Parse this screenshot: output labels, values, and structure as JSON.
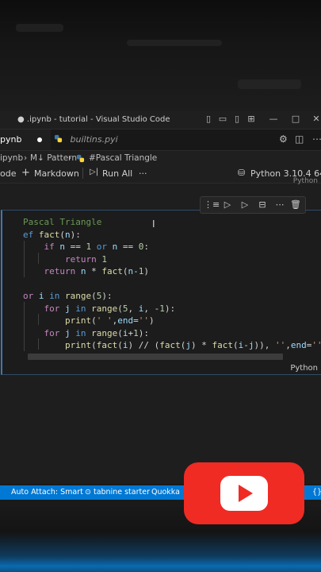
{
  "window": {
    "title": "● .ipynb - tutorial - Visual Studio Code",
    "controls": [
      "layout-sidebar-icon",
      "layout-panel-icon",
      "layout-sidebar-right-icon",
      "layout-grid-icon",
      "minimize-icon",
      "maximize-icon",
      "close-icon"
    ]
  },
  "tabs": [
    {
      "label": "pynb",
      "active": true,
      "dirty": true
    },
    {
      "label": "builtins.pyi",
      "active": false
    }
  ],
  "breadcrumb": {
    "file": "ipynb",
    "section": "M↓ Pattern",
    "cell": "#Pascal Triangle"
  },
  "toolbar": {
    "code": "ode",
    "markdown": "Markdown",
    "run_all": "Run All",
    "more": "···",
    "kernel": "Python 3.10.4 64-bi",
    "kernel_small": "Python"
  },
  "cell": {
    "language": "Python",
    "lines": [
      [
        {
          "t": "Pascal Triangle",
          "c": "cm"
        }
      ],
      [
        {
          "t": "ef ",
          "c": "kw"
        },
        {
          "t": "fact",
          "c": "fn"
        },
        {
          "t": "(",
          "c": "pl"
        },
        {
          "t": "n",
          "c": "var"
        },
        {
          "t": "):",
          "c": "pl"
        }
      ],
      [
        {
          "t": "    "
        },
        {
          "t": "if ",
          "c": "kw2"
        },
        {
          "t": "n",
          "c": "var"
        },
        {
          "t": " == ",
          "c": "pl"
        },
        {
          "t": "1",
          "c": "num"
        },
        {
          "t": " or ",
          "c": "kw"
        },
        {
          "t": "n",
          "c": "var"
        },
        {
          "t": " == ",
          "c": "pl"
        },
        {
          "t": "0",
          "c": "num"
        },
        {
          "t": ":",
          "c": "pl"
        }
      ],
      [
        {
          "t": "        "
        },
        {
          "t": "return ",
          "c": "kw2"
        },
        {
          "t": "1",
          "c": "num"
        }
      ],
      [
        {
          "t": "    "
        },
        {
          "t": "return ",
          "c": "kw2"
        },
        {
          "t": "n",
          "c": "var"
        },
        {
          "t": " * ",
          "c": "pl"
        },
        {
          "t": "fact",
          "c": "fn"
        },
        {
          "t": "(",
          "c": "pl"
        },
        {
          "t": "n",
          "c": "var"
        },
        {
          "t": "-",
          "c": "pl"
        },
        {
          "t": "1",
          "c": "num"
        },
        {
          "t": ")",
          "c": "pl"
        }
      ],
      [],
      [
        {
          "t": "or ",
          "c": "kw2"
        },
        {
          "t": "i",
          "c": "var"
        },
        {
          "t": " in ",
          "c": "kw"
        },
        {
          "t": "range",
          "c": "fn"
        },
        {
          "t": "(",
          "c": "pl"
        },
        {
          "t": "5",
          "c": "num"
        },
        {
          "t": "):",
          "c": "pl"
        }
      ],
      [
        {
          "t": "    "
        },
        {
          "t": "for ",
          "c": "kw2"
        },
        {
          "t": "j",
          "c": "var"
        },
        {
          "t": " in ",
          "c": "kw"
        },
        {
          "t": "range",
          "c": "fn"
        },
        {
          "t": "(",
          "c": "pl"
        },
        {
          "t": "5",
          "c": "num"
        },
        {
          "t": ", ",
          "c": "pl"
        },
        {
          "t": "i",
          "c": "var"
        },
        {
          "t": ", -",
          "c": "pl"
        },
        {
          "t": "1",
          "c": "num"
        },
        {
          "t": "):",
          "c": "pl"
        }
      ],
      [
        {
          "t": "        "
        },
        {
          "t": "print",
          "c": "fn"
        },
        {
          "t": "(",
          "c": "pl"
        },
        {
          "t": "' '",
          "c": "str"
        },
        {
          "t": ",",
          "c": "pl"
        },
        {
          "t": "end",
          "c": "var"
        },
        {
          "t": "=",
          "c": "pl"
        },
        {
          "t": "''",
          "c": "str"
        },
        {
          "t": ")",
          "c": "pl"
        }
      ],
      [
        {
          "t": "    "
        },
        {
          "t": "for ",
          "c": "kw2"
        },
        {
          "t": "j",
          "c": "var"
        },
        {
          "t": " in ",
          "c": "kw"
        },
        {
          "t": "range",
          "c": "fn"
        },
        {
          "t": "(",
          "c": "pl"
        },
        {
          "t": "i",
          "c": "var"
        },
        {
          "t": "+",
          "c": "pl"
        },
        {
          "t": "1",
          "c": "num"
        },
        {
          "t": "):",
          "c": "pl"
        }
      ],
      [
        {
          "t": "        "
        },
        {
          "t": "print",
          "c": "fn"
        },
        {
          "t": "(",
          "c": "pl"
        },
        {
          "t": "fact",
          "c": "fn"
        },
        {
          "t": "(",
          "c": "pl"
        },
        {
          "t": "i",
          "c": "var"
        },
        {
          "t": ") // (",
          "c": "pl"
        },
        {
          "t": "fact",
          "c": "fn"
        },
        {
          "t": "(",
          "c": "pl"
        },
        {
          "t": "j",
          "c": "var"
        },
        {
          "t": ") * ",
          "c": "pl"
        },
        {
          "t": "fact",
          "c": "fn"
        },
        {
          "t": "(",
          "c": "pl"
        },
        {
          "t": "i",
          "c": "var"
        },
        {
          "t": "-",
          "c": "pl"
        },
        {
          "t": "j",
          "c": "var"
        },
        {
          "t": ")), ",
          "c": "pl"
        },
        {
          "t": "''",
          "c": "str"
        },
        {
          "t": ",",
          "c": "pl"
        },
        {
          "t": "end",
          "c": "var"
        },
        {
          "t": "=",
          "c": "pl"
        },
        {
          "t": "''",
          "c": "str"
        },
        {
          "t": ")",
          "c": "pl"
        }
      ]
    ]
  },
  "statusbar": {
    "auto_attach": "Auto Attach: Smart",
    "tabnine": "⊙ tabnine starter",
    "quokka": "Quokka",
    "braces": "{}"
  },
  "colors": {
    "accent": "#0078d4",
    "youtube_red": "#ef2b24",
    "cell_border": "#3a79b8"
  }
}
